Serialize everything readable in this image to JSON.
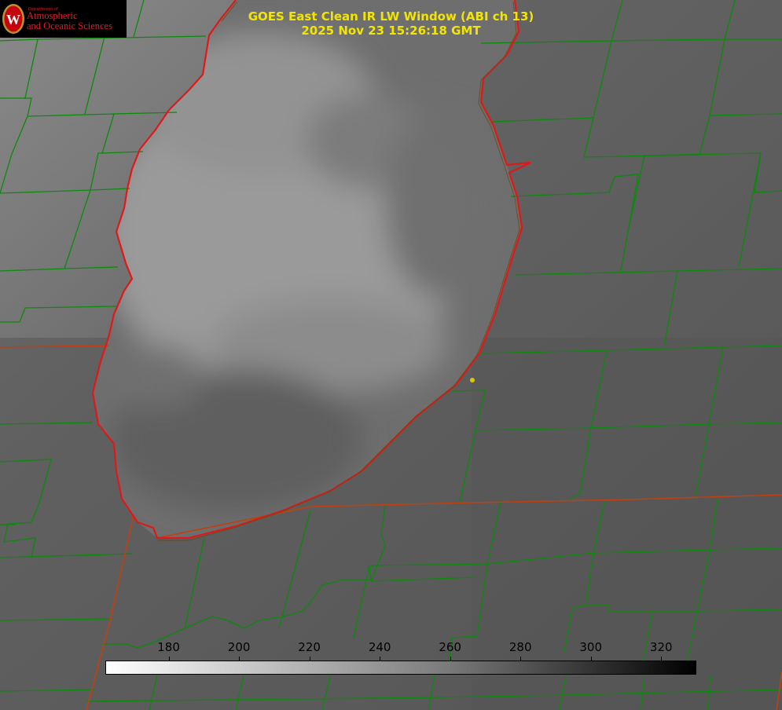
{
  "title": {
    "line1": "GOES East Clean IR LW Window (ABI ch 13)",
    "line2": "2025 Nov 23 15:26:18 GMT"
  },
  "logo": {
    "small": "Department of",
    "line1": "Atmospheric",
    "line2": "and Oceanic Sciences",
    "seal_letter": "W"
  },
  "colorbar": {
    "ticks": [
      "180",
      "200",
      "220",
      "240",
      "260",
      "280",
      "300",
      "320"
    ],
    "tick_values": [
      180,
      200,
      220,
      240,
      260,
      280,
      300,
      320
    ],
    "min": 162,
    "max": 330,
    "gradient": [
      "#ffffff",
      "#7a7a7a",
      "#000000"
    ]
  },
  "colors": {
    "title": "#f2e600",
    "county_lines": "#0b8a0b",
    "state_lines": "#c0400f",
    "lake_outline": "#e01818",
    "marker": "#e0c800",
    "logo_text": "#d82028"
  }
}
